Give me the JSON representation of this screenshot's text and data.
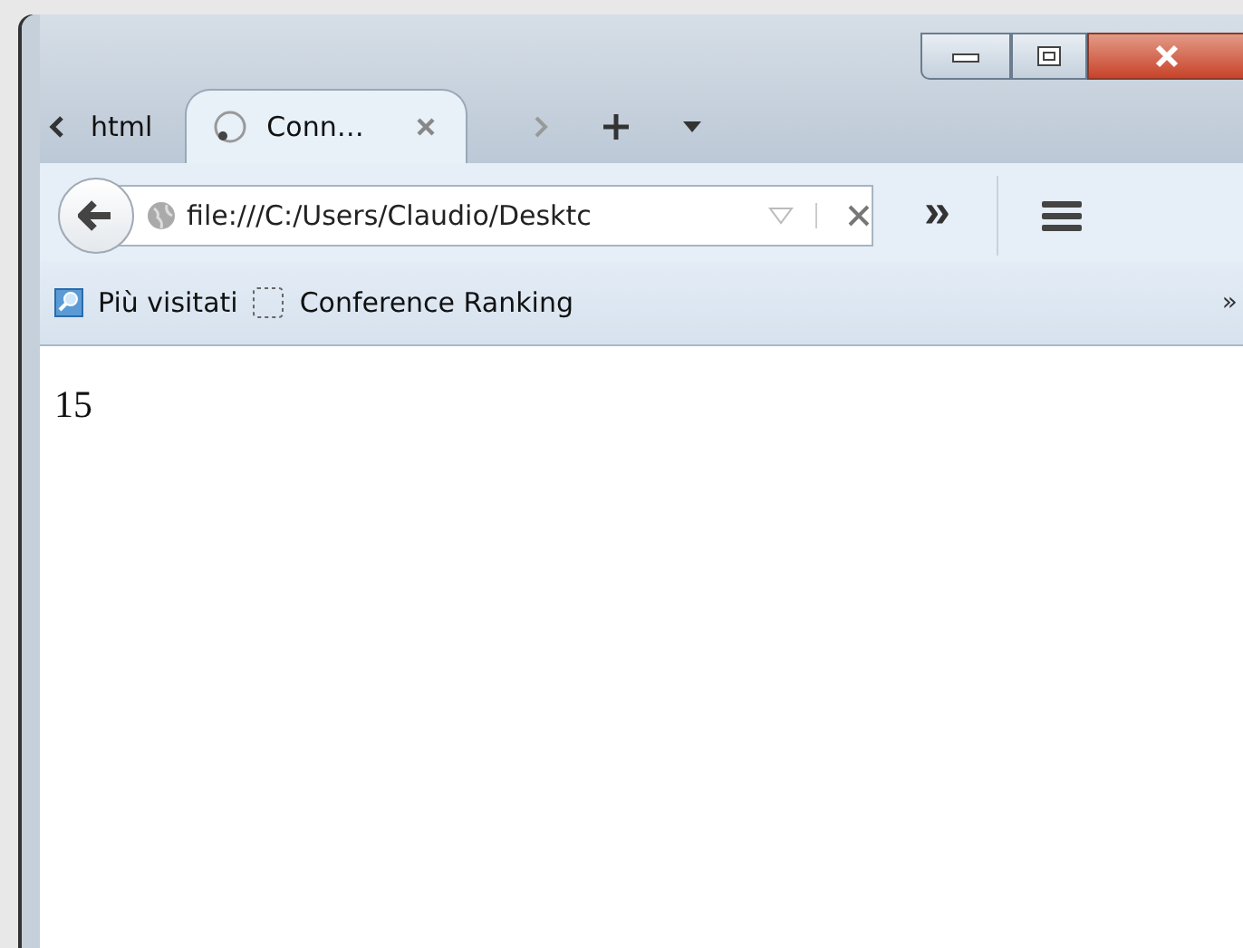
{
  "tabs": [
    {
      "label": "html",
      "selected": false
    },
    {
      "label": "Conn…",
      "selected": true
    }
  ],
  "address_bar": {
    "value": "file:///C:/Users/Claudio/Desktc"
  },
  "overflow_button": "»",
  "bookmarks": [
    {
      "kind": "search",
      "label": "Più visitati"
    },
    {
      "kind": "page",
      "label": "Conference Ranking"
    }
  ],
  "bookmarks_overflow": "»",
  "content": {
    "text": "15"
  }
}
